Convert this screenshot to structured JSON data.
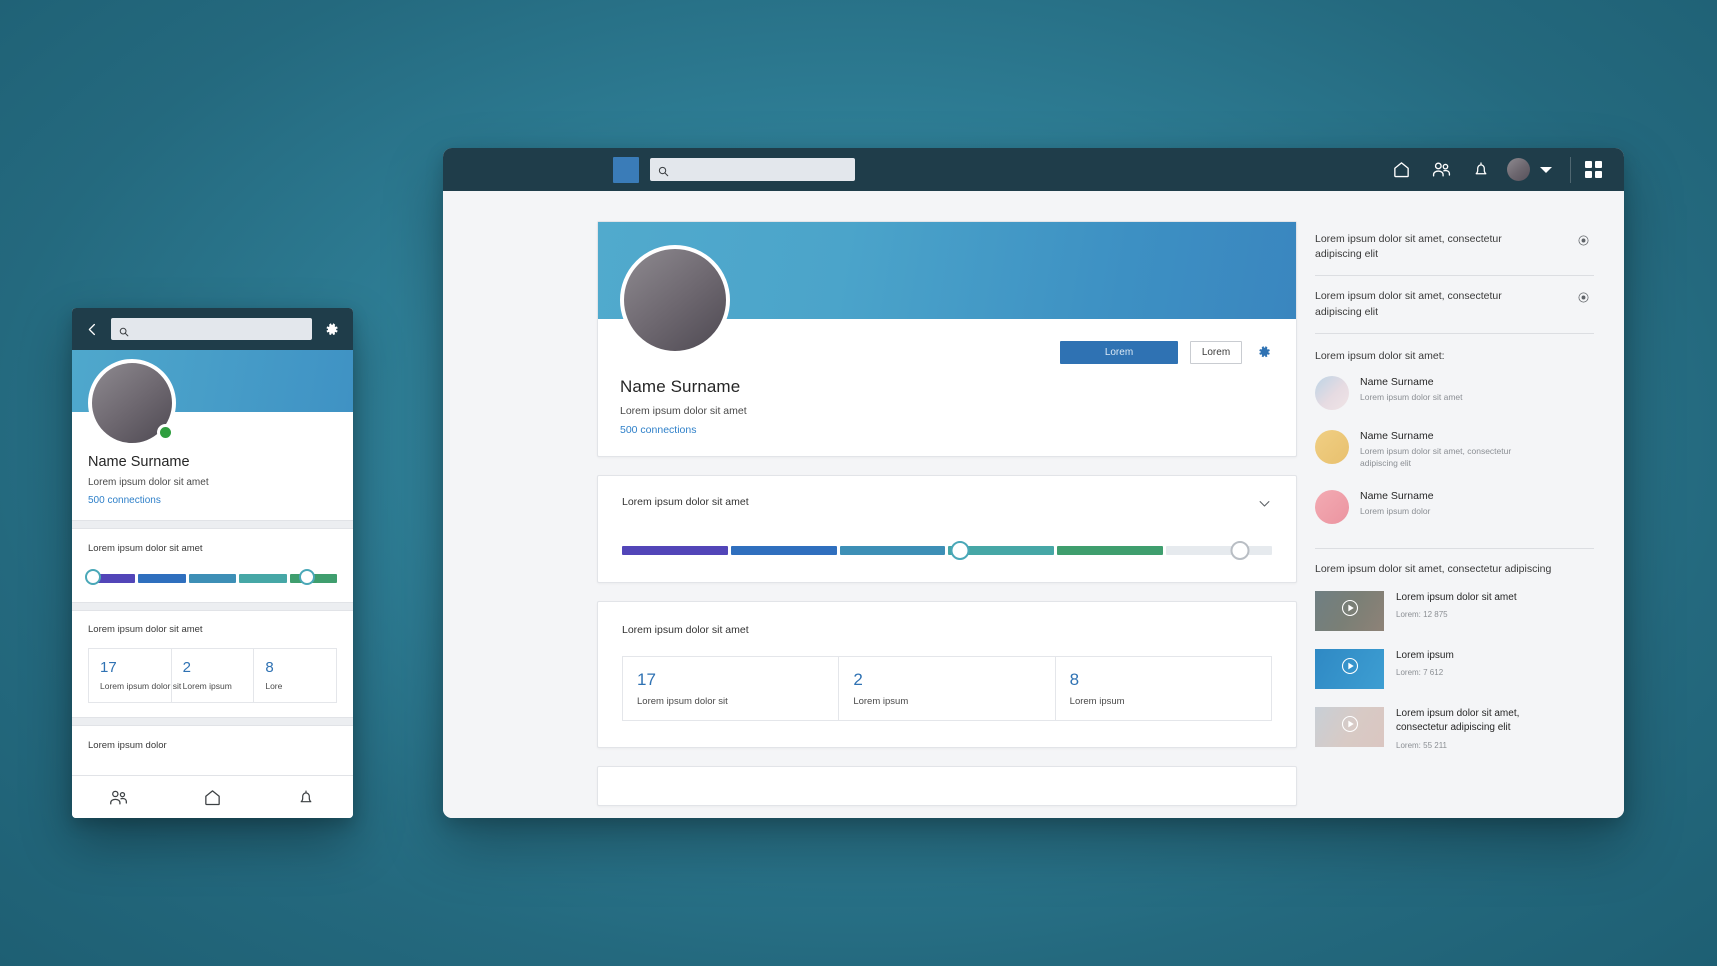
{
  "desktop": {
    "navbar": {
      "logo_name": "logo-tile",
      "search_placeholder": "",
      "search_value": "",
      "icons": [
        "home-icon",
        "people-icon",
        "bell-icon",
        "avatar",
        "chevron-down-icon",
        "grid-apps-icon"
      ]
    },
    "profile": {
      "name": "Name Surname",
      "subtitle": "Lorem ipsum dolor sit amet",
      "connections": "500 connections",
      "primary_button": "Lorem",
      "secondary_button": "Lorem",
      "settings_icon": "gear-icon"
    },
    "slider_card": {
      "title": "Lorem ipsum dolor sit amet",
      "collapse_icon": "chevron-down-icon",
      "segments": [
        "#5245b8",
        "#2f6fbe",
        "#3d8fb6",
        "#46a7a6",
        "#3f9e6e",
        "#e6eaee"
      ],
      "knob1_percent": 52,
      "knob2_percent": 95
    },
    "stats_card": {
      "title": "Lorem ipsum dolor sit amet",
      "stats": [
        {
          "number": "17",
          "label": "Lorem ipsum dolor sit"
        },
        {
          "number": "2",
          "label": "Lorem ipsum"
        },
        {
          "number": "8",
          "label": "Lorem ipsum"
        }
      ]
    },
    "rail": {
      "notices": [
        {
          "text": "Lorem ipsum dolor sit amet, consectetur adipiscing elit",
          "icon": "target-icon"
        },
        {
          "text": "Lorem ipsum dolor sit amet, consectetur adipiscing elit",
          "icon": "target-icon"
        }
      ],
      "people_heading": "Lorem ipsum dolor sit amet:",
      "people": [
        {
          "name": "Name Surname",
          "desc": "Lorem ipsum dolor sit amet"
        },
        {
          "name": "Name Surname",
          "desc": "Lorem ipsum dolor sit amet, consectetur adipiscing elit"
        },
        {
          "name": "Name Surname",
          "desc": "Lorem ipsum dolor"
        }
      ],
      "videos_heading": "Lorem ipsum dolor sit amet, consectetur adipiscing",
      "videos": [
        {
          "title": "Lorem ipsum dolor sit amet",
          "meta": "Lorem: 12 875"
        },
        {
          "title": "Lorem ipsum",
          "meta": "Lorem: 7 612"
        },
        {
          "title": "Lorem ipsum dolor sit amet, consectetur adipiscing elit",
          "meta": "Lorem: 55 211"
        }
      ]
    }
  },
  "mobile": {
    "topbar": {
      "back_icon": "chevron-left-icon",
      "search_placeholder": "",
      "search_value": "",
      "gear_icon": "gear-icon"
    },
    "profile": {
      "name": "Name Surname",
      "subtitle": "Lorem ipsum dolor sit amet",
      "connections": "500 connections",
      "status": "online"
    },
    "slider": {
      "title": "Lorem ipsum dolor sit amet",
      "segments": [
        "#5245b8",
        "#2f6fbe",
        "#3d8fb6",
        "#46a7a6",
        "#3f9e6e"
      ],
      "knob1_percent": 2,
      "knob2_percent": 88
    },
    "stats": {
      "title": "Lorem ipsum dolor sit amet",
      "items": [
        {
          "number": "17",
          "label": "Lorem ipsum dolor sit"
        },
        {
          "number": "2",
          "label": "Lorem ipsum"
        },
        {
          "number": "8",
          "label": "Lore"
        }
      ]
    },
    "footer_title": "Lorem ipsum dolor",
    "bottom_nav": [
      "people-icon",
      "home-icon",
      "bell-icon"
    ]
  },
  "colors": {
    "nav_bg": "#1f3d4a",
    "accent_blue": "#2f72b3",
    "link_blue": "#2f80c9",
    "online_green": "#2f9e3f",
    "page_bg": "#f4f5f7"
  }
}
